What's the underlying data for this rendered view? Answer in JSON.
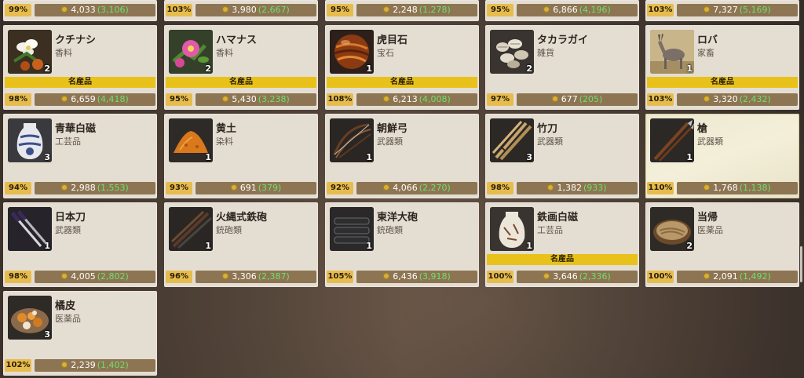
{
  "top_row": [
    {
      "pct": "99%",
      "price": "4,033",
      "base": "(3,106)"
    },
    {
      "pct": "103%",
      "price": "3,980",
      "base": "(2,667)"
    },
    {
      "pct": "95%",
      "price": "2,248",
      "base": "(1,278)"
    },
    {
      "pct": "95%",
      "price": "6,866",
      "base": "(4,196)"
    },
    {
      "pct": "103%",
      "price": "7,327",
      "base": "(5,169)"
    }
  ],
  "row1": [
    {
      "name": "クチナシ",
      "cat": "香料",
      "count": "2",
      "special": "名産品",
      "pct": "98%",
      "price": "6,659",
      "base": "(4,418)",
      "icon": "gardenia-icon"
    },
    {
      "name": "ハマナス",
      "cat": "香料",
      "count": "2",
      "special": "名産品",
      "pct": "95%",
      "price": "5,430",
      "base": "(3,238)",
      "icon": "rose-icon"
    },
    {
      "name": "虎目石",
      "cat": "宝石",
      "count": "1",
      "special": "名産品",
      "pct": "108%",
      "price": "6,213",
      "base": "(4,008)",
      "icon": "tigers-eye-icon"
    },
    {
      "name": "タカラガイ",
      "cat": "雑貨",
      "count": "2",
      "special": "",
      "pct": "97%",
      "price": "677",
      "base": "(205)",
      "icon": "cowrie-shell-icon"
    },
    {
      "name": "ロバ",
      "cat": "家畜",
      "count": "1",
      "special": "名産品",
      "pct": "103%",
      "price": "3,320",
      "base": "(2,432)",
      "icon": "donkey-icon"
    }
  ],
  "row2": [
    {
      "name": "青華白磁",
      "cat": "工芸品",
      "count": "3",
      "special": "",
      "pct": "94%",
      "price": "2,988",
      "base": "(1,553)",
      "icon": "porcelain-vase-icon"
    },
    {
      "name": "黄土",
      "cat": "染料",
      "count": "1",
      "special": "",
      "pct": "93%",
      "price": "691",
      "base": "(379)",
      "icon": "ochre-pile-icon"
    },
    {
      "name": "朝鮮弓",
      "cat": "武器類",
      "count": "1",
      "special": "",
      "pct": "92%",
      "price": "4,066",
      "base": "(2,270)",
      "icon": "bow-icon"
    },
    {
      "name": "竹刀",
      "cat": "武器類",
      "count": "3",
      "special": "",
      "pct": "98%",
      "price": "1,382",
      "base": "(933)",
      "icon": "bamboo-sword-icon"
    },
    {
      "name": "槍",
      "cat": "武器類",
      "count": "1",
      "special": "",
      "pct": "110%",
      "price": "1,768",
      "base": "(1,138)",
      "icon": "spear-icon"
    }
  ],
  "row3": [
    {
      "name": "日本刀",
      "cat": "武器類",
      "count": "1",
      "special": "",
      "pct": "98%",
      "price": "4,005",
      "base": "(2,802)",
      "icon": "katana-icon"
    },
    {
      "name": "火縄式鉄砲",
      "cat": "銃砲類",
      "count": "1",
      "special": "",
      "pct": "96%",
      "price": "3,306",
      "base": "(2,387)",
      "icon": "matchlock-icon"
    },
    {
      "name": "東洋大砲",
      "cat": "銃砲類",
      "count": "1",
      "special": "",
      "pct": "105%",
      "price": "6,436",
      "base": "(3,918)",
      "icon": "cannon-icon"
    },
    {
      "name": "鉄画白磁",
      "cat": "工芸品",
      "count": "1",
      "special": "名産品",
      "pct": "100%",
      "price": "3,646",
      "base": "(2,336)",
      "icon": "painted-vase-icon"
    },
    {
      "name": "当帰",
      "cat": "医薬品",
      "count": "2",
      "special": "",
      "pct": "100%",
      "price": "2,091",
      "base": "(1,492)",
      "icon": "angelica-root-icon"
    }
  ],
  "row4": [
    {
      "name": "橘皮",
      "cat": "医薬品",
      "count": "3",
      "special": "",
      "pct": "102%",
      "price": "2,239",
      "base": "(1,402)",
      "icon": "tangerine-peel-icon"
    }
  ],
  "colors": {
    "special": "#e8c21a",
    "pct": "#e7bc4e",
    "pricebar": "#8d7553",
    "base": "#6fe06a"
  }
}
